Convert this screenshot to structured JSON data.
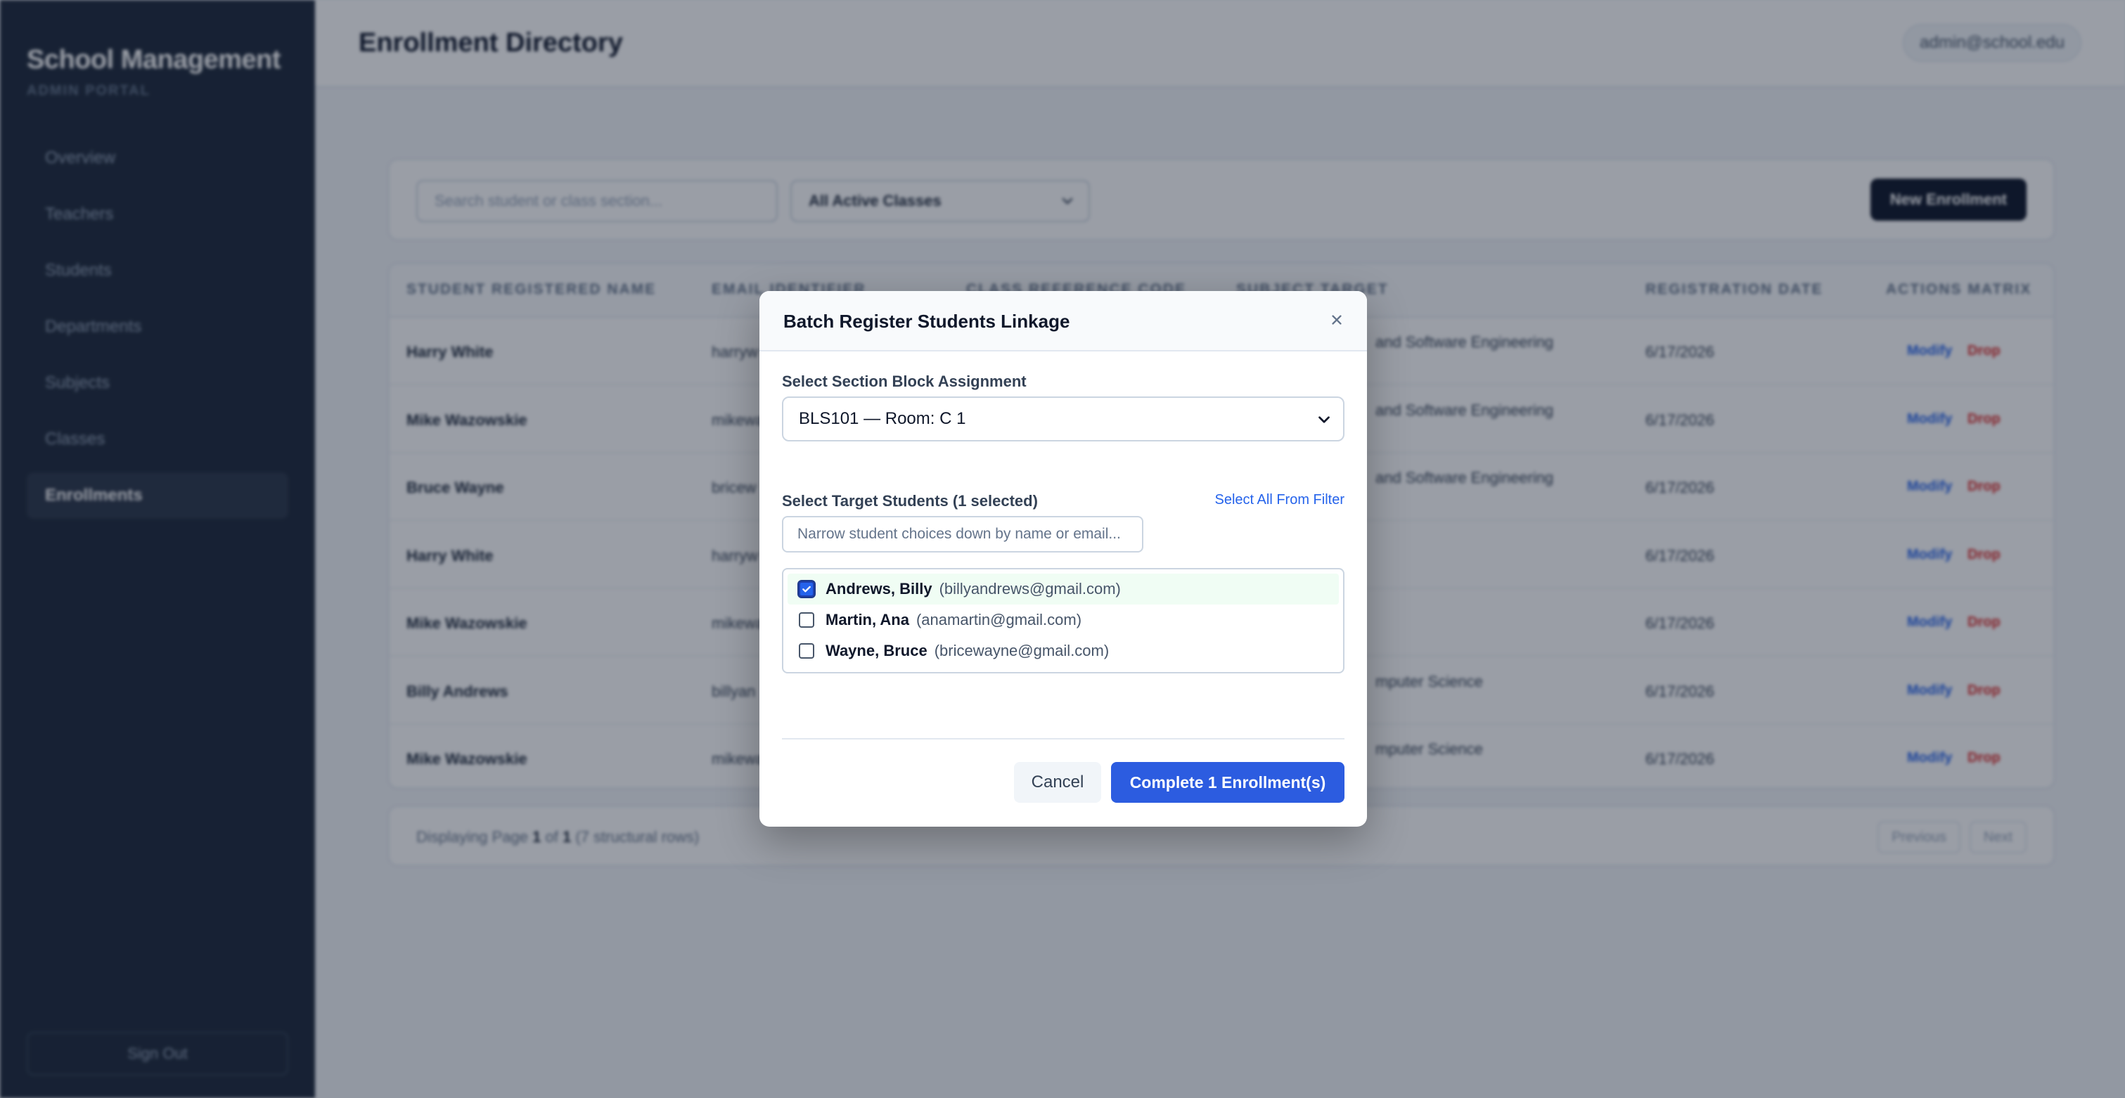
{
  "sidebar": {
    "brand_title": "School Management",
    "brand_subtitle": "ADMIN PORTAL",
    "items": [
      {
        "label": "Overview"
      },
      {
        "label": "Teachers"
      },
      {
        "label": "Students"
      },
      {
        "label": "Departments"
      },
      {
        "label": "Subjects"
      },
      {
        "label": "Classes"
      },
      {
        "label": "Enrollments",
        "active": true
      }
    ],
    "sign_out": "Sign Out"
  },
  "header": {
    "title": "Enrollment Directory",
    "user": "admin@school.edu"
  },
  "toolbar": {
    "search_placeholder": "Search student or class section...",
    "class_filter": "All Active Classes",
    "new_button": "New Enrollment"
  },
  "table": {
    "columns": [
      "STUDENT REGISTERED NAME",
      "EMAIL IDENTIFIER",
      "CLASS REFERENCE CODE",
      "SUBJECT TARGET",
      "REGISTRATION DATE",
      "ACTIONS MATRIX"
    ],
    "rows": [
      {
        "name": "Harry White",
        "email": "harryw",
        "subject": "and Software Engineering",
        "date": "6/17/2026"
      },
      {
        "name": "Mike Wazowskie",
        "email": "mikewa",
        "subject": "and Software Engineering",
        "date": "6/17/2026"
      },
      {
        "name": "Bruce Wayne",
        "email": "bricew",
        "subject": "and Software Engineering",
        "date": "6/17/2026"
      },
      {
        "name": "Harry White",
        "email": "harryw",
        "subject": "",
        "date": "6/17/2026"
      },
      {
        "name": "Mike Wazowskie",
        "email": "mikewa",
        "subject": "",
        "date": "6/17/2026"
      },
      {
        "name": "Billy Andrews",
        "email": "billyan",
        "subject": "mputer Science",
        "date": "6/17/2026"
      },
      {
        "name": "Mike Wazowskie",
        "email": "mikewa",
        "subject": "mputer Science",
        "date": "6/17/2026"
      }
    ],
    "modify_label": "Modify",
    "drop_label": "Drop"
  },
  "pagination": {
    "prefix": "Displaying Page",
    "page": "1",
    "of": "of",
    "total": "1",
    "suffix": "(7 structural rows)",
    "prev": "Previous",
    "next": "Next"
  },
  "modal": {
    "title": "Batch Register Students Linkage",
    "section_label": "Select Section Block Assignment",
    "section_value": "BLS101 — Room: C 1",
    "students_label": "Select Target Students (1 selected)",
    "select_all": "Select All From Filter",
    "narrow_placeholder": "Narrow student choices down by name or email...",
    "students": [
      {
        "name": "Andrews, Billy",
        "email": "(billyandrews@gmail.com)",
        "checked": true
      },
      {
        "name": "Martin, Ana",
        "email": "(anamartin@gmail.com)",
        "checked": false
      },
      {
        "name": "Wayne, Bruce",
        "email": "(bricewayne@gmail.com)",
        "checked": false
      }
    ],
    "cancel": "Cancel",
    "complete": "Complete 1 Enrollment(s)"
  },
  "colors": {
    "sidebar_bg": "#1e293b",
    "accent": "#2c5ce0",
    "danger": "#dc2626",
    "dark_button": "#0f172a"
  }
}
